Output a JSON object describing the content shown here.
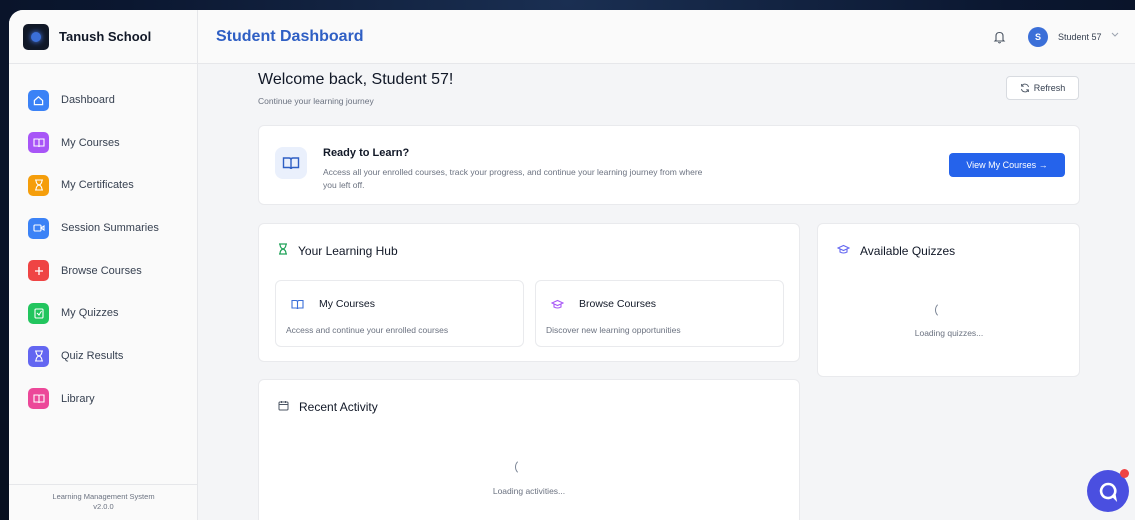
{
  "brand": {
    "name": "Tanush School"
  },
  "sidebar": {
    "items": [
      {
        "label": "Dashboard",
        "icon": "home-icon",
        "color": "#3b82f6"
      },
      {
        "label": "My Courses",
        "icon": "book-icon",
        "color": "#a855f7"
      },
      {
        "label": "My Certificates",
        "icon": "hourglass-icon",
        "color": "#f59e0b"
      },
      {
        "label": "Session Summaries",
        "icon": "video-icon",
        "color": "#3b82f6"
      },
      {
        "label": "Browse Courses",
        "icon": "plus-icon",
        "color": "#ef4444"
      },
      {
        "label": "My Quizzes",
        "icon": "clipboard-icon",
        "color": "#22c55e"
      },
      {
        "label": "Quiz Results",
        "icon": "hourglass-icon",
        "color": "#6366f1"
      },
      {
        "label": "Library",
        "icon": "book-icon",
        "color": "#ec4899"
      }
    ],
    "footer_line1": "Learning Management System",
    "footer_line2": "v2.0.0"
  },
  "header": {
    "title": "Student Dashboard",
    "avatar_initial": "S",
    "user_name": "Student 57"
  },
  "main": {
    "welcome": "Welcome back, Student 57!",
    "welcome_sub": "Continue your learning journey",
    "refresh_label": "Refresh",
    "ready": {
      "title": "Ready to Learn?",
      "description": "Access all your enrolled courses, track your progress, and continue your learning journey from where you left off.",
      "button_label": "View My Courses →"
    },
    "hub": {
      "title": "Your Learning Hub",
      "my_courses_title": "My Courses",
      "my_courses_desc": "Access and continue your enrolled courses",
      "browse_title": "Browse Courses",
      "browse_desc": "Discover new learning opportunities"
    },
    "quizzes": {
      "title": "Available Quizzes",
      "loading": "Loading quizzes..."
    },
    "activity": {
      "title": "Recent Activity",
      "loading": "Loading activities..."
    }
  },
  "colors": {
    "accent": "#2563eb",
    "title_blue": "#2f5fc4",
    "chat_bubble": "#4a4fe0"
  }
}
